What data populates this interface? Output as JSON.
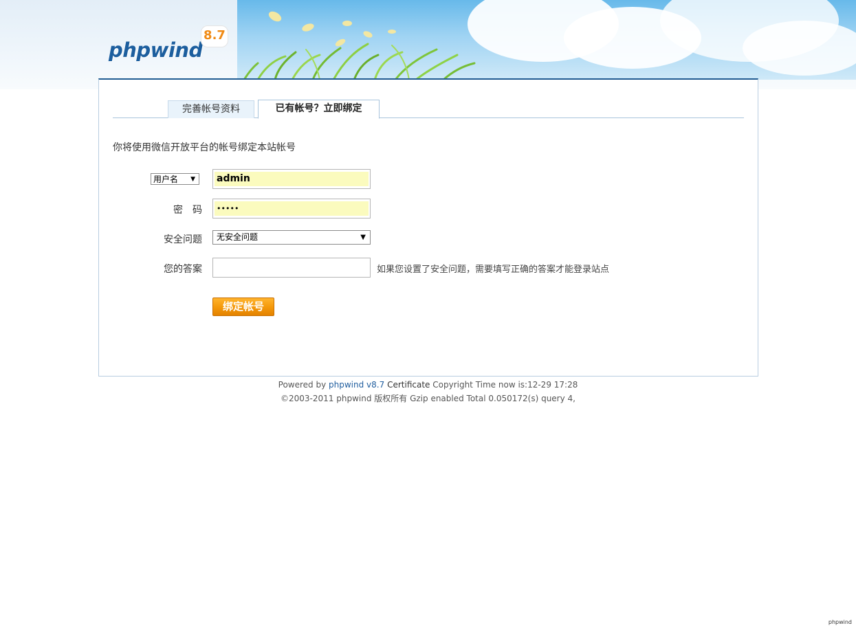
{
  "header": {
    "logo_text": "phpwind",
    "logo_version": "8.7"
  },
  "tabs": [
    {
      "label": "完善帐号资料"
    },
    {
      "label": "已有帐号？立即绑定"
    }
  ],
  "form": {
    "intro": "你将使用微信开放平台的帐号绑定本站帐号",
    "login_type_selected": "用户名",
    "username_value": "admin",
    "password_label": "密　码",
    "password_mask": "•••••",
    "security_question_label": "安全问题",
    "security_question_selected": "无安全问题",
    "answer_label": "您的答案",
    "answer_value": "",
    "answer_hint": "如果您设置了安全问题，需要填写正确的答案才能登录站点",
    "submit_label": "绑定帐号"
  },
  "footer": {
    "powered_by": "Powered by",
    "product": "phpwind v8.7",
    "certificate": "Certificate",
    "time_text": "Copyright Time now is:12-29 17:28",
    "line2": "©2003-2011 phpwind 版权所有 Gzip enabled Total 0.050172(s) query 4,"
  },
  "corner_text": "phpwind"
}
